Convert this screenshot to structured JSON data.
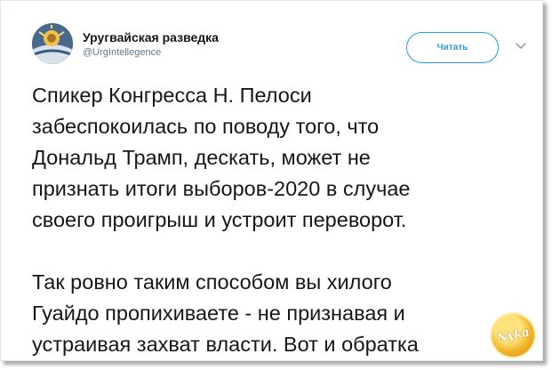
{
  "author": {
    "name": "Уругвайская разведка",
    "handle": "@UrgIntellegence"
  },
  "follow_label": "Читать",
  "tweet": {
    "paragraph1": [
      "Спикер Конгресса Н. Пелоси",
      "забеспокоилась по поводу того, что",
      "Дональд Трамп, дескать, может не",
      "признать итоги выборов-2020 в случае",
      "своего проигрыш и устроит переворот."
    ],
    "paragraph2": [
      "Так ровно таким способом вы хилого",
      "Гуайдо пропихиваете - не признавая и",
      "устраивая захват власти. Вот и обратка"
    ]
  },
  "watermark_text": "Nyka",
  "colors": {
    "accent": "#1da1f2",
    "text": "#14171a",
    "muted": "#657786"
  },
  "icons": {
    "menu": "chevron-down-icon"
  }
}
